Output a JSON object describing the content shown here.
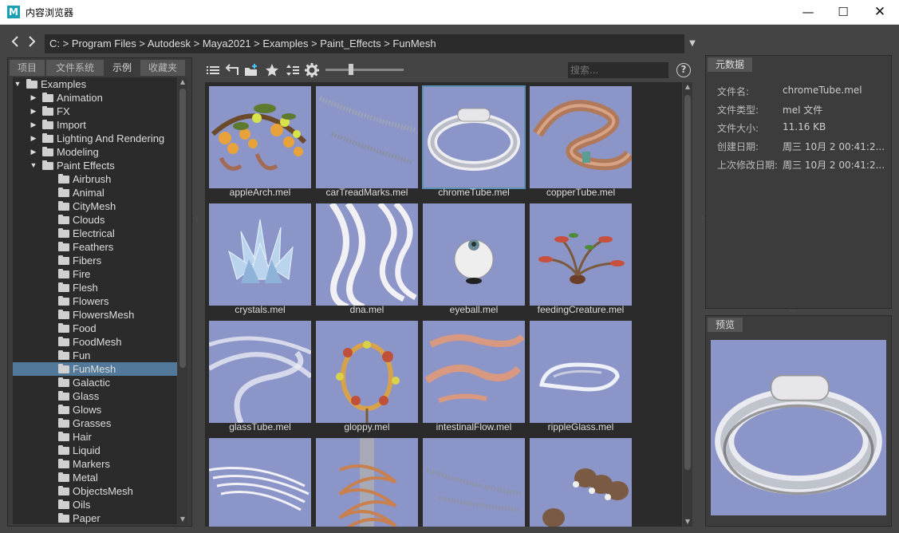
{
  "window": {
    "title": "内容浏览器",
    "logo": "M",
    "minimize": "—",
    "maximize": "☐",
    "close": "✕"
  },
  "nav": {
    "back_icon": "chevron-left-icon",
    "forward_icon": "chevron-right-icon",
    "path": "C:  >  Program Files  >  Autodesk  >  Maya2021  >  Examples  >  Paint_Effects  >  FunMesh"
  },
  "tabs": [
    {
      "label": "项目"
    },
    {
      "label": "文件系统"
    },
    {
      "label": "示例",
      "active": true
    },
    {
      "label": "收藏夹"
    }
  ],
  "tree": [
    {
      "label": "Examples",
      "depth": 0,
      "arrow": "down"
    },
    {
      "label": "Animation",
      "depth": 1,
      "arrow": "right"
    },
    {
      "label": "FX",
      "depth": 1,
      "arrow": "right"
    },
    {
      "label": "Import",
      "depth": 1,
      "arrow": "right"
    },
    {
      "label": "Lighting And Rendering",
      "depth": 1,
      "arrow": "right"
    },
    {
      "label": "Modeling",
      "depth": 1,
      "arrow": "right"
    },
    {
      "label": "Paint Effects",
      "depth": 1,
      "arrow": "down"
    },
    {
      "label": "Airbrush",
      "depth": 2
    },
    {
      "label": "Animal",
      "depth": 2
    },
    {
      "label": "CityMesh",
      "depth": 2
    },
    {
      "label": "Clouds",
      "depth": 2
    },
    {
      "label": "Electrical",
      "depth": 2
    },
    {
      "label": "Feathers",
      "depth": 2
    },
    {
      "label": "Fibers",
      "depth": 2
    },
    {
      "label": "Fire",
      "depth": 2
    },
    {
      "label": "Flesh",
      "depth": 2
    },
    {
      "label": "Flowers",
      "depth": 2
    },
    {
      "label": "FlowersMesh",
      "depth": 2
    },
    {
      "label": "Food",
      "depth": 2
    },
    {
      "label": "FoodMesh",
      "depth": 2
    },
    {
      "label": "Fun",
      "depth": 2
    },
    {
      "label": "FunMesh",
      "depth": 2,
      "selected": true
    },
    {
      "label": "Galactic",
      "depth": 2
    },
    {
      "label": "Glass",
      "depth": 2
    },
    {
      "label": "Glows",
      "depth": 2
    },
    {
      "label": "Grasses",
      "depth": 2
    },
    {
      "label": "Hair",
      "depth": 2
    },
    {
      "label": "Liquid",
      "depth": 2
    },
    {
      "label": "Markers",
      "depth": 2
    },
    {
      "label": "Metal",
      "depth": 2
    },
    {
      "label": "ObjectsMesh",
      "depth": 2
    },
    {
      "label": "Oils",
      "depth": 2
    },
    {
      "label": "Paper",
      "depth": 2
    }
  ],
  "toolbar": {
    "icons": [
      "list-view-icon",
      "return-icon",
      "new-folder-icon",
      "favorite-star-icon",
      "sort-icon",
      "settings-gear-icon"
    ],
    "zoom_level": 0.3,
    "search_placeholder": "搜索...",
    "help": "?"
  },
  "files": [
    {
      "name": "appleArch.mel",
      "art": "apple"
    },
    {
      "name": "carTreadMarks.mel",
      "art": "tread"
    },
    {
      "name": "chromeTube.mel",
      "art": "chrome",
      "selected": true
    },
    {
      "name": "copperTube.mel",
      "art": "copper"
    },
    {
      "name": "crystals.mel",
      "art": "crystals"
    },
    {
      "name": "dna.mel",
      "art": "dna"
    },
    {
      "name": "eyeball.mel",
      "art": "eyeball"
    },
    {
      "name": "feedingCreature.mel",
      "art": "creature"
    },
    {
      "name": "glassTube.mel",
      "art": "glasstube"
    },
    {
      "name": "gloppy.mel",
      "art": "gloppy"
    },
    {
      "name": "intestinalFlow.mel",
      "art": "intestinal"
    },
    {
      "name": "rippleGlass.mel",
      "art": "ripple"
    },
    {
      "name": "",
      "art": "ribbons"
    },
    {
      "name": "",
      "art": "spiral"
    },
    {
      "name": "",
      "art": "tread2"
    },
    {
      "name": "",
      "art": "baskets"
    }
  ],
  "metadata": {
    "tab": "元数据",
    "rows": [
      {
        "key": "文件名:",
        "value": "chromeTube.mel"
      },
      {
        "key": "文件类型:",
        "value": "mel 文件"
      },
      {
        "key": "文件大小:",
        "value": "11.16 KB"
      },
      {
        "key": "创建日期:",
        "value": "周三 10月 2 00:41:2..."
      },
      {
        "key": "上次修改日期:",
        "value": "周三 10月 2 00:41:2..."
      }
    ]
  },
  "preview": {
    "tab": "预览"
  },
  "colors": {
    "thumb_bg": "#8b95c8",
    "selection": "#52799a",
    "panel": "#3c3c3c",
    "field": "#2b2b2b"
  }
}
